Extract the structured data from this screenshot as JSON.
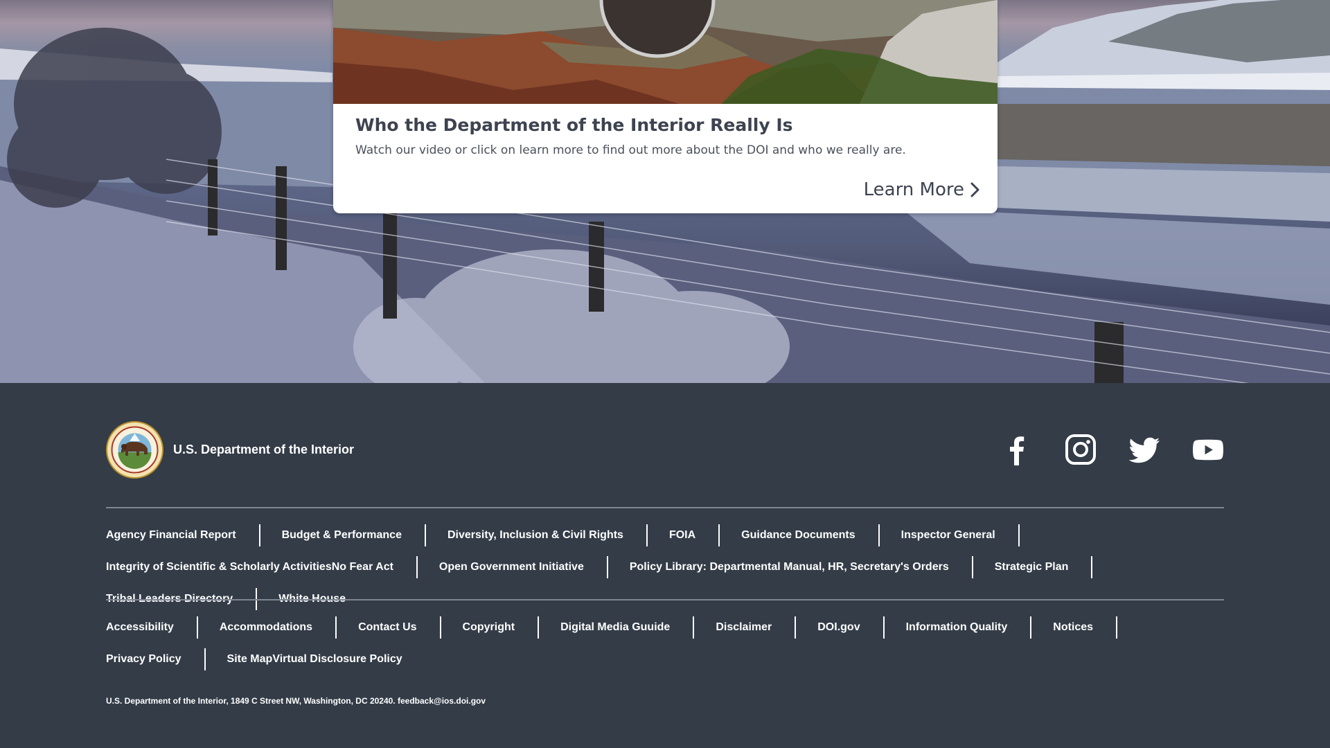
{
  "colors": {
    "footer_bg": "#333c47",
    "card_bg": "#ffffff",
    "card_title": "#3d4350",
    "footer_text": "#ffffff"
  },
  "card": {
    "title": "Who the Department of the Interior Really Is",
    "description": "Watch our video or click on learn more to find out more about the DOI and who we really are.",
    "learn_more_label": "Learn More",
    "image_icon": "play-button-circle"
  },
  "footer": {
    "agency_name": "U.S. Department of the Interior",
    "logo_icon": "doi-seal-bison",
    "social": [
      {
        "name": "facebook-icon"
      },
      {
        "name": "instagram-icon"
      },
      {
        "name": "twitter-icon"
      },
      {
        "name": "youtube-icon"
      }
    ],
    "primary_links": [
      "Agency Financial Report",
      "Budget & Performance",
      "Diversity, Inclusion & Civil Rights",
      "FOIA",
      "Guidance Documents",
      "Inspector General",
      "Integrity of Scientific & Scholarly Activities",
      "No Fear Act",
      "Open Government Initiative",
      "Policy Library: Departmental Manual, HR, Secretary's Orders",
      "Strategic Plan",
      "Tribal Leaders Directory",
      "White House"
    ],
    "secondary_links": [
      "Accessibility",
      "Accommodations",
      "Contact Us",
      "Copyright",
      "Digital Media Guuide",
      "Disclaimer",
      "DOI.gov",
      "Information Quality",
      "Notices",
      "Privacy Policy",
      "Site Map",
      "Virtual Disclosure Policy"
    ],
    "address": "U.S. Department of the Interior, 1849 C Street NW, Washington, DC 20240. feedback@ios.doi.gov"
  }
}
